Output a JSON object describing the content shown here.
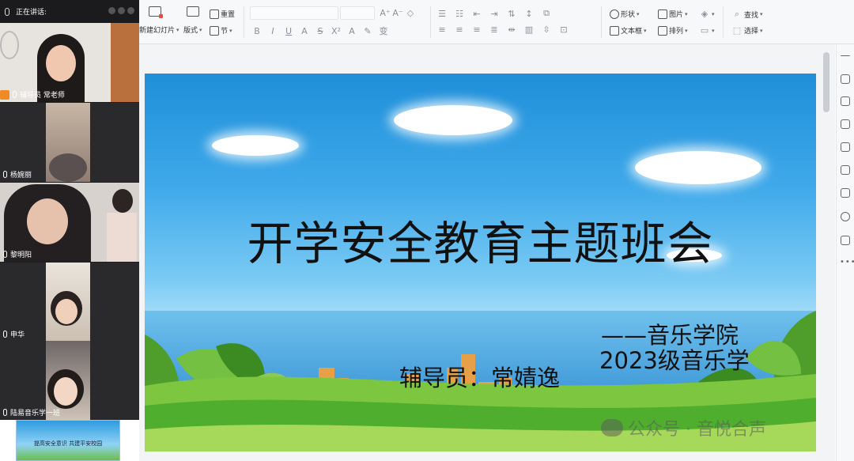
{
  "video_panel": {
    "speaking_label": "正在讲话:",
    "participants": [
      {
        "name": "辅导员 常老师",
        "role_badge": true
      },
      {
        "name": "杨婉丽"
      },
      {
        "name": "黎明阳"
      },
      {
        "name": "申华"
      },
      {
        "name": "陆易音乐学一班"
      }
    ]
  },
  "ribbon": {
    "new_slide": "新建幻灯片",
    "layout": "版式",
    "reset": "重置",
    "section": "节",
    "shape": "形状",
    "picture": "图片",
    "find": "查找",
    "textbox": "文本框",
    "arrange": "排列",
    "select": "选择"
  },
  "slide": {
    "title": "开学安全教育主题班会",
    "line1": "——音乐学院",
    "line2": "2023级音乐学",
    "counselor": "辅导员：常婧逸"
  },
  "thumbnail": {
    "caption": "提高安全意识  共建平安校园"
  },
  "watermark": "公众号 · 音悦合声",
  "colors": {
    "accent_orange": "#f08a24",
    "sky_blue": "#3fa9ea",
    "grass_green": "#5db53a"
  }
}
